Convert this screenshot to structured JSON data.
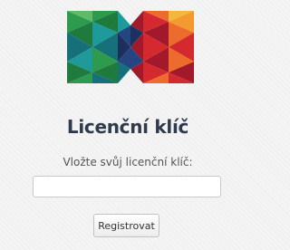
{
  "logo": {
    "icon": "bowtie-triangles-logo",
    "colors": {
      "green_dark": "#1f7a3e",
      "green": "#2e9a4d",
      "green_light": "#5dbb6a",
      "teal": "#1f9a9a",
      "teal_dark": "#16707a",
      "blue": "#24457f",
      "navy": "#1d2f5e",
      "red_dark": "#a3192b",
      "red": "#d42a2f",
      "orange": "#ec6b2d",
      "orange_light": "#f39a2f",
      "yellow": "#f5b73b"
    }
  },
  "title": "Licenční klíč",
  "form": {
    "label": "Vložte svůj licenční klíč:",
    "input_value": "",
    "input_placeholder": "",
    "submit_label": "Registrovat"
  }
}
